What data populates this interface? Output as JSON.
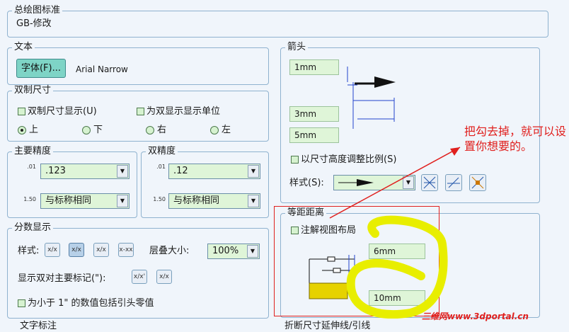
{
  "drafting_standard": {
    "title": "总绘图标准",
    "value": "GB-修改"
  },
  "text_group": {
    "title": "文本",
    "font_button": "字体(F)...",
    "font_name": "Arial Narrow"
  },
  "dual_dim": {
    "title": "双制尺寸",
    "show_dual": "双制尺寸显示(U)",
    "show_units": "为双显示显示单位",
    "positions": [
      "上",
      "下",
      "右",
      "左"
    ],
    "selected": "上"
  },
  "primary_precision": {
    "title": "主要精度",
    "value": ".123",
    "tolerance": "与标称相同",
    "icon1": ".01",
    "icon2": "1.50"
  },
  "dual_precision": {
    "title": "双精度",
    "value": ".12",
    "tolerance": "与标称相同",
    "icon1": ".01",
    "icon2": "1.50"
  },
  "fraction": {
    "title": "分数显示",
    "style_label": "样式:",
    "stack_label": "层叠大小:",
    "stack_value": "100%",
    "dual_label": "显示双对主要标记(\"):",
    "zero_label": "为小于 1\" 的数值包括引头零值",
    "style_icons": [
      "x/x",
      "x/x",
      "x/x",
      "x-xx"
    ],
    "dual_icons": [
      "x/x'",
      "x/x"
    ]
  },
  "arrows": {
    "title": "箭头",
    "size1": "1mm",
    "size2": "3mm",
    "size3": "5mm",
    "scale_label": "以尺寸高度调整比例(S)",
    "style_label": "样式(S):"
  },
  "offset": {
    "title": "等距距离",
    "annotation_layout": "注解视图布局",
    "dist1": "6mm",
    "dist2": "10mm"
  },
  "annotation_note": "把勾去掉，就可以设置你想要的。",
  "bottom_left_partial": "文字标注",
  "bottom_right_partial": "折断尺寸延伸线/引线",
  "watermark": "三维网www.3dportal.cn",
  "colors": {
    "highlight_red": "#e0201e",
    "highlight_yellow": "#e8ee00",
    "field_green": "#dff5d8"
  }
}
